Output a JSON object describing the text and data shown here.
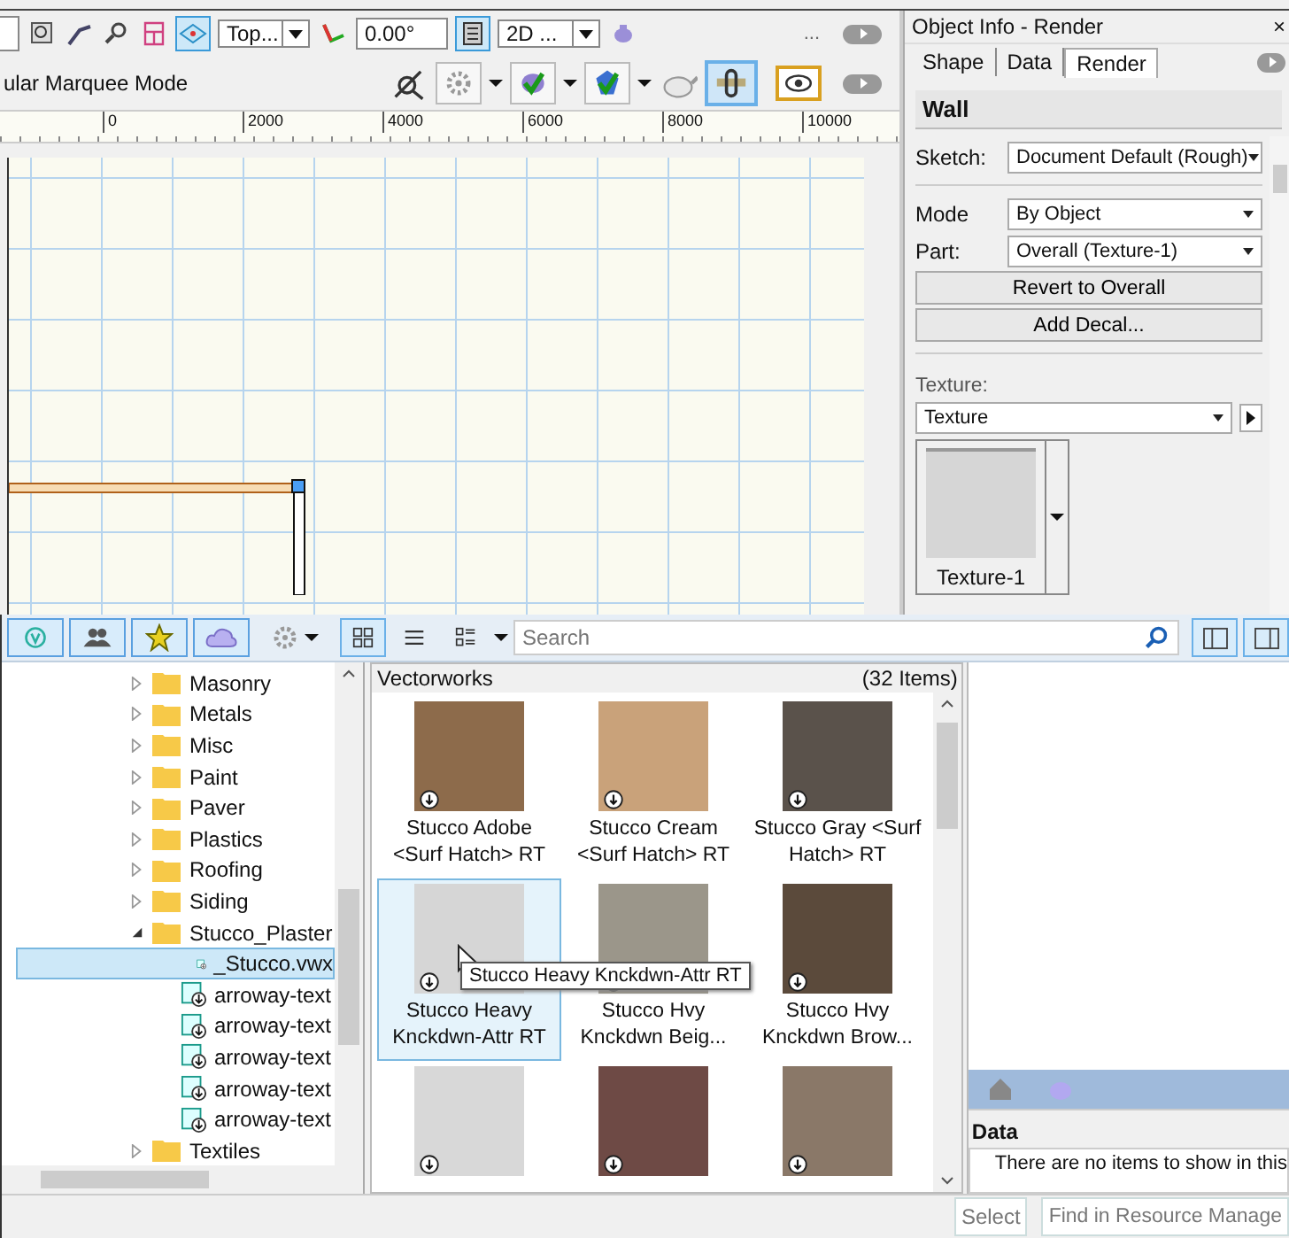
{
  "toolbar": {
    "view_dropdown": "Top...",
    "angle_field": "0.00°",
    "render_dropdown": "2D ...",
    "overflow": "..."
  },
  "mode_bar": {
    "mode_label": "ular Marquee Mode"
  },
  "ruler": {
    "ticks": [
      "0",
      "2000",
      "4000",
      "6000",
      "8000",
      "10000"
    ]
  },
  "object_info": {
    "title": "Object Info - Render",
    "close": "×",
    "tabs": [
      {
        "label": "Shape",
        "selected": false
      },
      {
        "label": "Data",
        "selected": false
      },
      {
        "label": "Render",
        "selected": true
      }
    ],
    "object_type": "Wall",
    "fields": [
      {
        "kind": "dropdown",
        "label": "Sketch:",
        "value": "Document Default (Rough)"
      },
      {
        "kind": "separator"
      },
      {
        "kind": "dropdown",
        "label": "Mode",
        "value": "By Object"
      },
      {
        "kind": "dropdown",
        "label": "Part:",
        "value": "Overall (Texture-1)"
      },
      {
        "kind": "button",
        "value": "Revert to Overall"
      },
      {
        "kind": "button",
        "value": "Add Decal..."
      },
      {
        "kind": "separator"
      }
    ],
    "texture_label": "Texture:",
    "texture_dropdown": "Texture",
    "texture_swatch": "Texture-1"
  },
  "resource_manager": {
    "view_buttons": [
      {
        "kind": "grid",
        "selected": true
      },
      {
        "kind": "list",
        "selected": false
      },
      {
        "kind": "details",
        "selected": false
      }
    ],
    "search": {
      "placeholder": "Search"
    },
    "tree": [
      {
        "label": "Masonry",
        "kind": "folder",
        "expanded": false,
        "selected": false
      },
      {
        "label": "Metals",
        "kind": "folder",
        "expanded": false,
        "selected": false
      },
      {
        "label": "Misc",
        "kind": "folder",
        "expanded": false,
        "selected": false
      },
      {
        "label": "Paint",
        "kind": "folder",
        "expanded": false,
        "selected": false
      },
      {
        "label": "Paver",
        "kind": "folder",
        "expanded": false,
        "selected": false
      },
      {
        "label": "Plastics",
        "kind": "folder",
        "expanded": false,
        "selected": false
      },
      {
        "label": "Roofing",
        "kind": "folder",
        "expanded": false,
        "selected": false
      },
      {
        "label": "Siding",
        "kind": "folder",
        "expanded": false,
        "selected": false
      },
      {
        "label": "Stucco_Plaster",
        "kind": "folder",
        "expanded": true,
        "selected": false,
        "children": [
          {
            "label": "_Stucco.vwx",
            "kind": "file",
            "selected": true
          },
          {
            "label": "arroway-text",
            "kind": "file",
            "selected": false
          },
          {
            "label": "arroway-text",
            "kind": "file",
            "selected": false
          },
          {
            "label": "arroway-text",
            "kind": "file",
            "selected": false
          },
          {
            "label": "arroway-text",
            "kind": "file",
            "selected": false
          },
          {
            "label": "arroway-text",
            "kind": "file",
            "selected": false
          }
        ]
      },
      {
        "label": "Textiles",
        "kind": "folder",
        "expanded": false,
        "selected": false
      }
    ],
    "browser": {
      "title": "Vectorworks",
      "count": "(32 Items)",
      "items": [
        {
          "name": "Stucco Adobe <Surf Hatch> RT",
          "color": "#8d6b4b",
          "selected": false
        },
        {
          "name": "Stucco Cream <Surf Hatch> RT",
          "color": "#c9a27a",
          "selected": false
        },
        {
          "name": "Stucco Gray <Surf Hatch> RT",
          "color": "#5a524b",
          "selected": false
        },
        {
          "name": "Stucco Heavy Knckdwn-Attr RT",
          "color": "#d6d6d6",
          "selected": true
        },
        {
          "name": "Stucco Hvy Knckdwn Beig...",
          "color": "#9b968a",
          "selected": false
        },
        {
          "name": "Stucco Hvy Knckdwn Brow...",
          "color": "#5b4a3b",
          "selected": false
        },
        {
          "color": "#d8d8d8",
          "selected": false
        },
        {
          "color": "#6e4a45",
          "selected": false
        },
        {
          "color": "#8a7868",
          "selected": false
        }
      ]
    },
    "tooltip": "Stucco Heavy Knckdwn-Attr RT",
    "data_heading": "Data",
    "data_message": "There are no items to show in this",
    "buttons": [
      "Select",
      "Find in Resource Manage"
    ]
  }
}
